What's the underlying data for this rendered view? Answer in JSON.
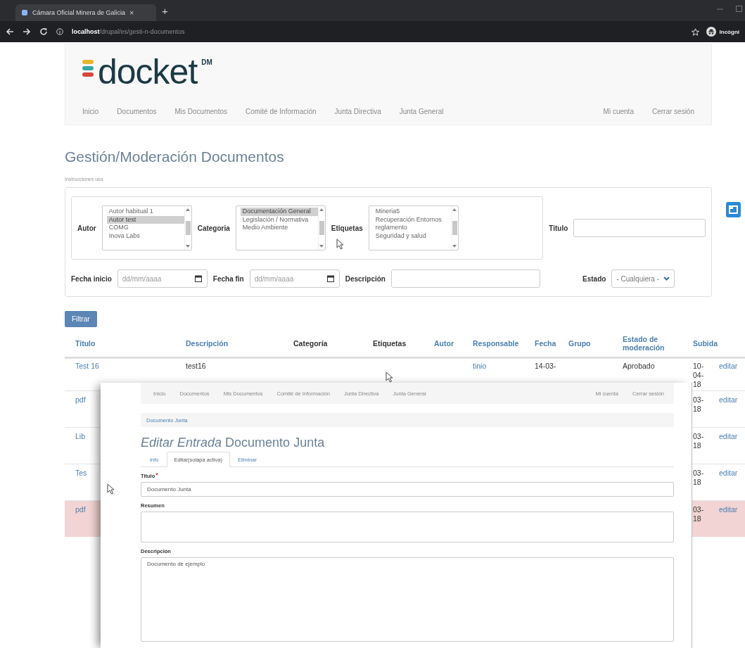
{
  "browser": {
    "tab_title": "Cámara Oficial Minera de Galicia",
    "tab_close": "×",
    "new_tab": "+",
    "url": "**localhost**/drupal/es/gesti-n-documentos",
    "profile": "Incógni"
  },
  "header": {
    "logo": "docket",
    "logo_mark": "DM",
    "nav_left": [
      "Inicio",
      "Documentos",
      "Mis Documentos",
      "Comité de Información",
      "Junta Directiva",
      "Junta General"
    ],
    "nav_right": [
      "Mi cuenta",
      "Cerrar sesión"
    ]
  },
  "page_title": "Gestión/Moderación Documentos",
  "instructions": "Instrucciones uso",
  "filters": {
    "lists": [
      {
        "label": "Autor",
        "options": [
          {
            "label": "Autor habitual 1",
            "selected": false
          },
          {
            "label": "Autor test",
            "selected": true
          },
          {
            "label": "COMG",
            "selected": false
          },
          {
            "label": "Inova Labs",
            "selected": false
          }
        ]
      },
      {
        "label": "Categoria",
        "options": [
          {
            "label": "Documentación General",
            "selected": true
          },
          {
            "label": "Legislación / Normativa",
            "selected": false
          },
          {
            "label": "Medio Ambiente",
            "selected": false
          }
        ]
      },
      {
        "label": "Etiquetas",
        "options": [
          {
            "label": "Mineria5",
            "selected": false
          },
          {
            "label": "Recuperación Entornos",
            "selected": false
          },
          {
            "label": "reglamento",
            "selected": false
          },
          {
            "label": "Seguridad y salud",
            "selected": false
          }
        ]
      }
    ],
    "titulo_label": "Titulo",
    "dates": [
      {
        "label": "Fecha inicio",
        "placeholder": "dd/mm/aaaa"
      },
      {
        "label": "Fecha fin",
        "placeholder": "dd/mm/aaaa"
      }
    ],
    "descripcion_label": "Descripción",
    "estado": {
      "label": "Estado",
      "value": "- Cualquiera -"
    }
  },
  "filter_button": "Filtrar",
  "table": {
    "columns": [
      {
        "label": "Titulo",
        "kind": "link"
      },
      {
        "label": "Descripción",
        "kind": "link"
      },
      {
        "label": "Categoría",
        "kind": "plain"
      },
      {
        "label": "Etiquetas",
        "kind": "plain"
      },
      {
        "label": "Autor",
        "kind": "link"
      },
      {
        "label": "Responsable",
        "kind": "link"
      },
      {
        "label": "Fecha",
        "kind": "link"
      },
      {
        "label": "Grupo",
        "kind": "link"
      },
      {
        "label": "Estado de moderación",
        "kind": "link"
      },
      {
        "label": "Subida",
        "kind": "link"
      }
    ],
    "rows": [
      {
        "highlighted": false,
        "titulo": "Test 16",
        "descripcion": "test16",
        "responsable": "tinio",
        "fecha": "14-03-",
        "estado": "Aprobado",
        "subida": "10-04-18",
        "action": "editar"
      },
      {
        "highlighted": false,
        "titulo": "pdf",
        "subida": "03-18",
        "action": "editar"
      },
      {
        "highlighted": false,
        "titulo": "Lib",
        "subida": "03-18",
        "action": "editar"
      },
      {
        "highlighted": false,
        "titulo": "Tes",
        "subida": "03-18",
        "action": "editar"
      },
      {
        "highlighted": true,
        "titulo": "pdf",
        "subida": "03-18",
        "action": "editar"
      }
    ]
  },
  "edit_window": {
    "nav_left": [
      "Inicio",
      "Documentos",
      "Mis Documentos",
      "Comité de Información",
      "Junta Directiva",
      "Junta General"
    ],
    "nav_right": [
      "Mi cuenta",
      "Cerrar sesión"
    ],
    "breadcrumb": "Documento Junta",
    "heading": "*Editar Entrada* Documento Junta",
    "tabs": [
      {
        "label": "Info",
        "selected": false
      },
      {
        "label": "Editar(solapa activa)",
        "selected": true
      },
      {
        "label": "Eliminar",
        "selected": false
      }
    ],
    "fields": [
      {
        "kind": "input",
        "label": "Titulo",
        "required_mark": "*",
        "value": "Documento Junta"
      },
      {
        "kind": "textarea",
        "label": "Resumen"
      },
      {
        "kind": "textarea_tall",
        "label": "Descripción",
        "value": "Documento de ejemplo"
      }
    ]
  }
}
